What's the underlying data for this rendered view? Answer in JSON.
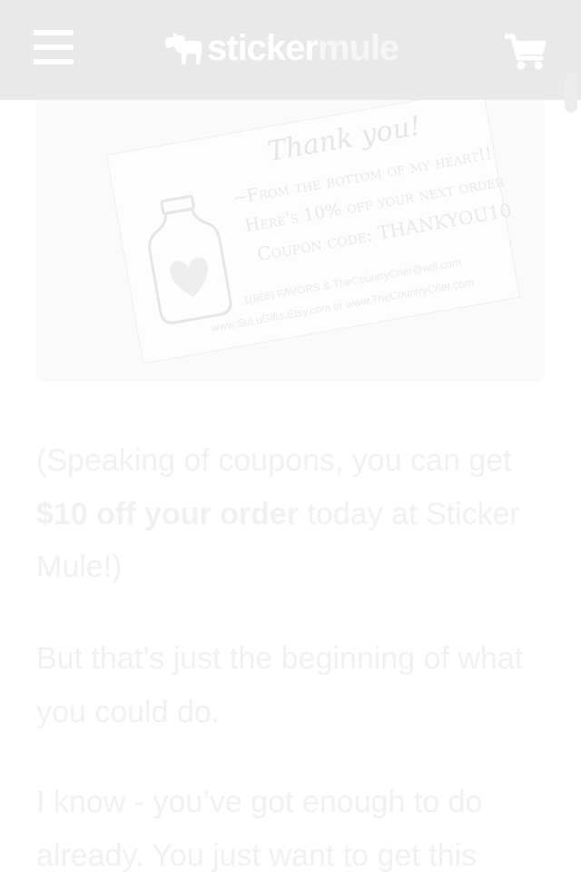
{
  "header": {
    "logo_part1": "sticker",
    "logo_part2": "mule",
    "menu_icon": "hamburger-menu-icon",
    "cart_icon": "shopping-cart-icon",
    "background_color": "#e9e9e9"
  },
  "image": {
    "card_title": "Thank you!",
    "card_line1": "~From the bottom of my heart!!",
    "card_line2": "Here's 10% off your next order",
    "card_line3": "Coupon code: THANKYOU10",
    "card_line4": "1(866) FAVORS &  TheCountryCrier@aol.com",
    "card_line5": "www.SuLuGifts.Etsy.com or  www.TheCountryCrier.com"
  },
  "content": {
    "p1_before": "(Speaking of coupons, you can get ",
    "p1_link": "$10 off your order",
    "p1_after": " today at Sticker Mule!)",
    "p2": "But that’s just the beginning of what you could do.",
    "p3": "I know - you’ve got enough to do already. You just want to get this"
  }
}
